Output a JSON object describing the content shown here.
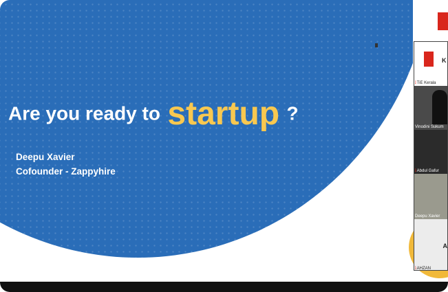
{
  "slide": {
    "title_prefix": "Are you ready to",
    "title_highlight": "startup",
    "title_suffix": "?",
    "presenter_name": "Deepu Xavier",
    "presenter_role": "Cofounder - Zappyhire"
  },
  "participants": [
    {
      "name": "TiE Kerala"
    },
    {
      "name": "Vinodini Sukum"
    },
    {
      "name": "Abdul Gafur"
    },
    {
      "name": "Deepu Xavier"
    },
    {
      "name": "AHZAN"
    }
  ],
  "colors": {
    "slide_blue": "#2a6db8",
    "highlight_yellow": "#f8c850",
    "tie_red": "#d9261c",
    "circle_yellow": "#f1b93a"
  }
}
